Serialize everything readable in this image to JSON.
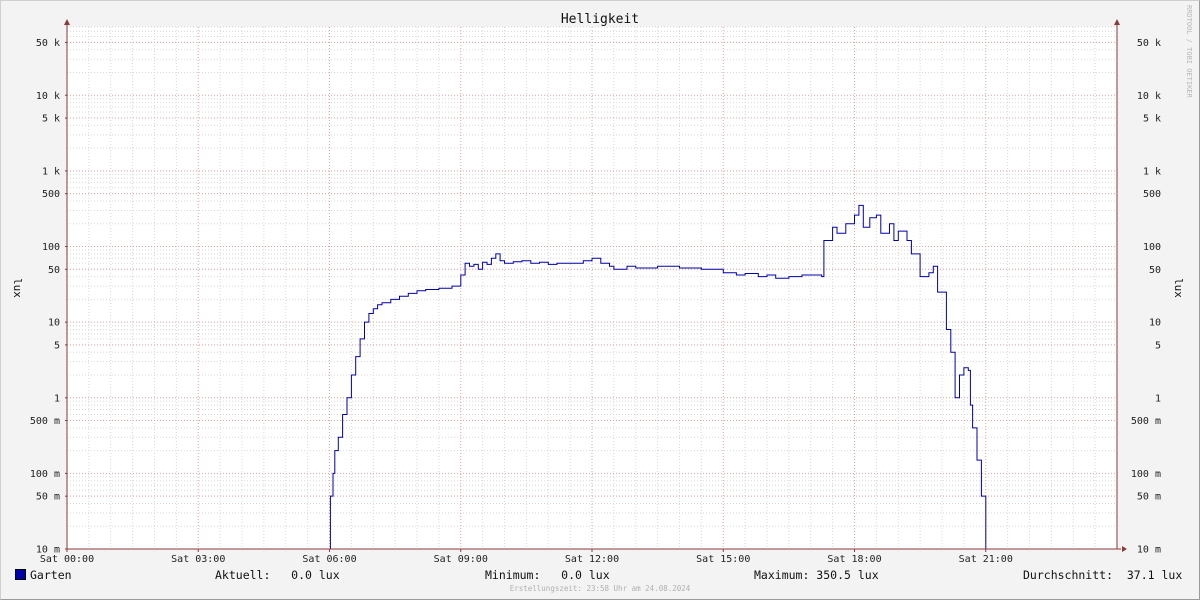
{
  "chart_data": {
    "type": "line",
    "title": "Helligkeit",
    "ylabel": "lux",
    "yscale": "log",
    "ylim": [
      0.01,
      80000
    ],
    "xlim_hours": [
      0,
      24
    ],
    "x_ticks": [
      {
        "h": 0,
        "label": "Sat 00:00"
      },
      {
        "h": 3,
        "label": "Sat 03:00"
      },
      {
        "h": 6,
        "label": "Sat 06:00"
      },
      {
        "h": 9,
        "label": "Sat 09:00"
      },
      {
        "h": 12,
        "label": "Sat 12:00"
      },
      {
        "h": 15,
        "label": "Sat 15:00"
      },
      {
        "h": 18,
        "label": "Sat 18:00"
      },
      {
        "h": 21,
        "label": "Sat 21:00"
      }
    ],
    "y_ticks": [
      {
        "v": 50000,
        "label": "50 k"
      },
      {
        "v": 10000,
        "label": "10 k"
      },
      {
        "v": 5000,
        "label": "5 k"
      },
      {
        "v": 1000,
        "label": "1 k"
      },
      {
        "v": 500,
        "label": "500"
      },
      {
        "v": 100,
        "label": "100"
      },
      {
        "v": 50,
        "label": "50"
      },
      {
        "v": 10,
        "label": "10"
      },
      {
        "v": 5,
        "label": "5"
      },
      {
        "v": 1,
        "label": "1"
      },
      {
        "v": 0.5,
        "label": "500 m"
      },
      {
        "v": 0.1,
        "label": "100 m"
      },
      {
        "v": 0.05,
        "label": "50 m"
      },
      {
        "v": 0.01,
        "label": "10 m"
      }
    ],
    "grid": true,
    "legend": "bottom-left",
    "series": [
      {
        "name": "Garten",
        "color": "#0000aa",
        "x_hours": [
          0,
          6.0,
          6.02,
          6.05,
          6.08,
          6.12,
          6.2,
          6.3,
          6.4,
          6.5,
          6.6,
          6.7,
          6.8,
          6.9,
          7.0,
          7.1,
          7.2,
          7.4,
          7.6,
          7.8,
          8.0,
          8.2,
          8.5,
          8.8,
          9.0,
          9.1,
          9.2,
          9.3,
          9.4,
          9.5,
          9.6,
          9.7,
          9.8,
          9.9,
          10.0,
          10.2,
          10.4,
          10.6,
          10.8,
          11.0,
          11.2,
          11.5,
          11.8,
          12.0,
          12.2,
          12.4,
          12.5,
          12.8,
          13.0,
          13.5,
          14.0,
          14.5,
          15.0,
          15.3,
          15.5,
          15.8,
          16.0,
          16.2,
          16.5,
          16.8,
          17.0,
          17.25,
          17.3,
          17.5,
          17.6,
          17.8,
          18.0,
          18.1,
          18.2,
          18.35,
          18.5,
          18.6,
          18.8,
          18.9,
          19.0,
          19.2,
          19.3,
          19.5,
          19.7,
          19.8,
          19.9,
          20.1,
          20.2,
          20.3,
          20.4,
          20.5,
          20.6,
          20.65,
          20.7,
          20.8,
          20.9,
          20.95,
          21.0,
          21.05,
          21.1,
          24.0
        ],
        "y": [
          0.01,
          0.01,
          0.05,
          0.05,
          0.1,
          0.2,
          0.3,
          0.6,
          1.0,
          2.0,
          3.5,
          6.0,
          10.0,
          13.0,
          15.0,
          17.0,
          18.0,
          20.0,
          22.0,
          24.0,
          26.0,
          27.0,
          28.0,
          30.0,
          42.0,
          60.0,
          55.0,
          58.0,
          50.0,
          62.0,
          58.0,
          70.0,
          80.0,
          65.0,
          60.0,
          63.0,
          65.0,
          60.0,
          62.0,
          58.0,
          60.0,
          60.0,
          65.0,
          70.0,
          60.0,
          55.0,
          50.0,
          55.0,
          52.0,
          55.0,
          52.0,
          50.0,
          45.0,
          42.0,
          44.0,
          40.0,
          42.0,
          38.0,
          40.0,
          42.0,
          42.0,
          40.0,
          120.0,
          180.0,
          150.0,
          200.0,
          260.0,
          350.0,
          180.0,
          240.0,
          260.0,
          150.0,
          200.0,
          120.0,
          160.0,
          120.0,
          80.0,
          40.0,
          45.0,
          55.0,
          25.0,
          8.0,
          4.0,
          1.0,
          2.0,
          2.5,
          2.3,
          0.8,
          0.4,
          0.15,
          0.05,
          0.05,
          0.01,
          0.01,
          0.01,
          0.01
        ]
      }
    ]
  },
  "legend": {
    "series_name": "Garten",
    "current": "Aktuell:   0.0 lux",
    "minimum": "Minimum:   0.0 lux",
    "maximum": "Maximum: 350.5 lux",
    "average": "Durchschnitt:  37.1 lux"
  },
  "watermark": "RRDTOOL / TOBI OETIKER",
  "footer": "Erstellungszeit: 23:58 Uhr am 24.08.2024",
  "colors": {
    "line": "#0000aa",
    "minor_grid": "#d8d8d8",
    "major_grid": "#e8a0a0",
    "axis": "#8a3a3a",
    "plot_bg": "#ffffff",
    "page_bg": "#f3f3f3"
  }
}
